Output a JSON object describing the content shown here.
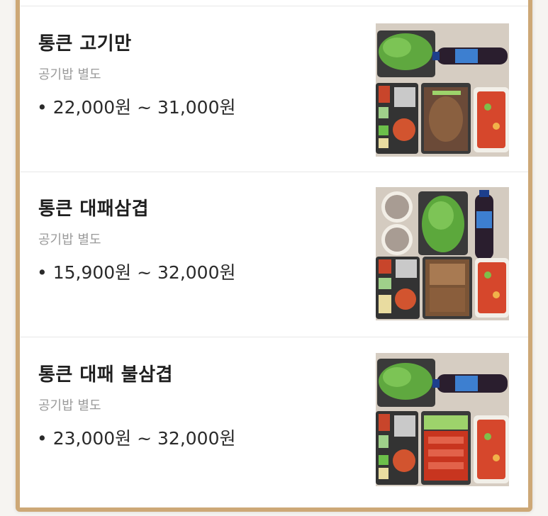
{
  "menu": {
    "items": [
      {
        "name": "통큰 고기만",
        "note": "공기밥 별도",
        "price": "• 22,000원 ~ 31,000원",
        "image": "meal-box-photo"
      },
      {
        "name": "통큰 대패삼겹",
        "note": "공기밥 별도",
        "price": "• 15,900원 ~ 32,000원",
        "image": "meal-box-photo"
      },
      {
        "name": "통큰 대패 불삼겹",
        "note": "공기밥 별도",
        "price": "• 23,000원 ~ 32,000원",
        "image": "meal-box-photo"
      }
    ]
  },
  "colors": {
    "frame": "#cda877",
    "name_text": "#1f1f1f",
    "note_text": "#9a9a9a",
    "price_text": "#2a2a2a"
  }
}
